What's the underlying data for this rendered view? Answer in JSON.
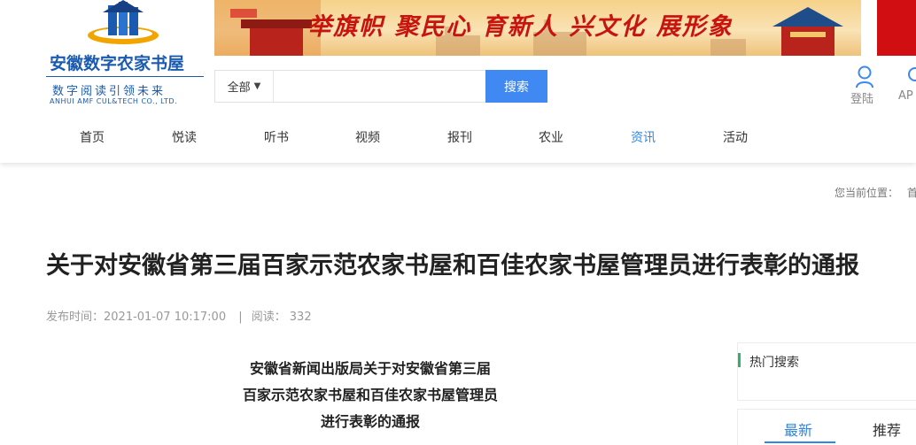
{
  "logo": {
    "title": "安徽数字农家书屋",
    "slogan": "数字阅读引领未来",
    "english": "ANHUI AMF CUL&TECH CO., LTD."
  },
  "banner": {
    "text": "举旗帜 聚民心 育新人 兴文化 展形象"
  },
  "search": {
    "category": "全部",
    "placeholder": "",
    "value": "",
    "button_label": "搜索"
  },
  "user": {
    "login_label": "登陆",
    "app_label": "AP"
  },
  "nav": {
    "items": [
      {
        "label": "首页"
      },
      {
        "label": "悦读"
      },
      {
        "label": "听书"
      },
      {
        "label": "视频"
      },
      {
        "label": "报刊"
      },
      {
        "label": "农业"
      },
      {
        "label": "资讯"
      },
      {
        "label": "活动"
      }
    ],
    "active_index": 6
  },
  "breadcrumb": {
    "prefix": "您当前位置：",
    "first": "首"
  },
  "article": {
    "title": "关于对安徽省第三届百家示范农家书屋和百佳农家书屋管理员进行表彰的通报",
    "publish_label": "发布时间：",
    "publish_time": "2021-01-07 10:17:00",
    "separator": "|",
    "read_label": "阅读：",
    "read_count": "332",
    "doc_heading": [
      "安徽省新闻出版局关于对安徽省第三届",
      "百家示范农家书屋和百佳农家书屋管理员",
      "进行表彰的通报"
    ]
  },
  "sidebar": {
    "hot_search_title": "热门搜索",
    "tabs": [
      {
        "label": "最新"
      },
      {
        "label": "推荐"
      }
    ]
  },
  "colors": {
    "accent": "#4189f2",
    "nav_active": "#2f86e8",
    "brand": "#1a5bb0",
    "banner_red": "#c8140f",
    "hot_bar": "#33b06a"
  }
}
